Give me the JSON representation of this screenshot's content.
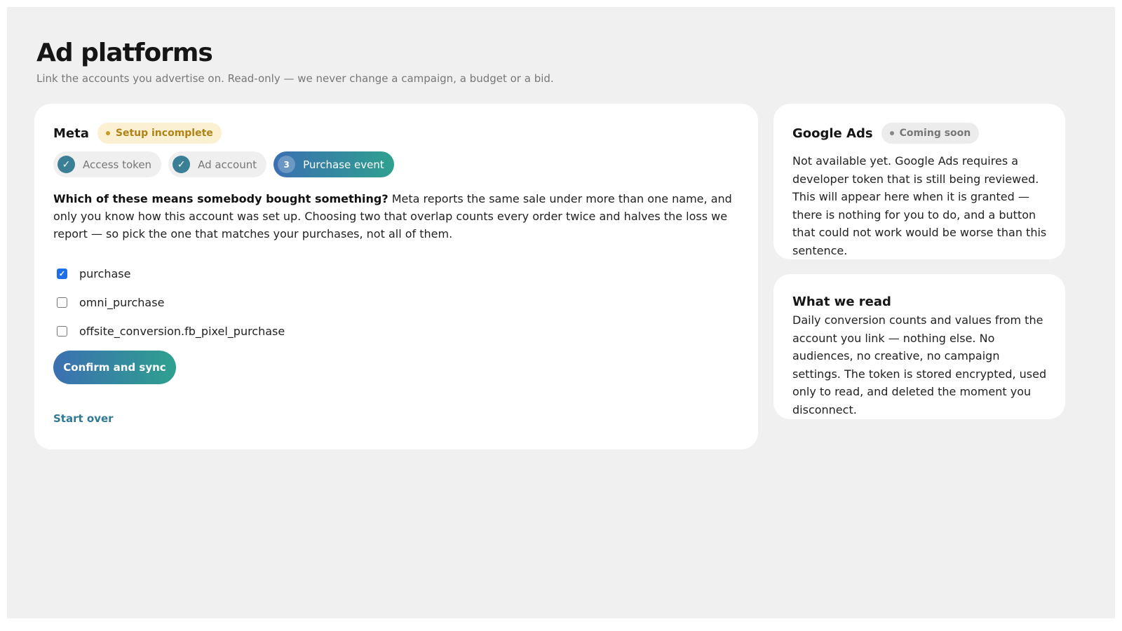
{
  "page": {
    "title": "Ad platforms",
    "subtitle": "Link the accounts you advertise on. Read-only — we never change a campaign, a budget or a bid."
  },
  "meta_card": {
    "name": "Meta",
    "status_badge": "Setup incomplete",
    "steps": [
      {
        "label": "Access token",
        "state": "done",
        "icon": "check-icon"
      },
      {
        "label": "Ad account",
        "state": "done",
        "icon": "check-icon"
      },
      {
        "label": "Purchase event",
        "state": "active",
        "number": "3"
      }
    ],
    "prompt_bold": "Which of these means somebody bought something?",
    "prompt_text": " Meta reports the same sale under more than one name, and only you know how this account was set up. Choosing two that overlap counts every order twice and halves the loss we report — so pick the one that matches your purchases, not all of them.",
    "options": [
      {
        "label": "purchase",
        "checked": true
      },
      {
        "label": "omni_purchase",
        "checked": false
      },
      {
        "label": "offsite_conversion.fb_pixel_purchase",
        "checked": false
      }
    ],
    "confirm_label": "Confirm and sync",
    "start_over_label": "Start over"
  },
  "google_card": {
    "name": "Google Ads",
    "status_badge": "Coming soon",
    "text": "Not available yet. Google Ads requires a developer token that is still being reviewed. This will appear here when it is granted — there is nothing for you to do, and a button that could not work would be worse than this sentence."
  },
  "read_card": {
    "title": "What we read",
    "text": "Daily conversion counts and values from the account you link — nothing else. No audiences, no creative, no campaign settings. The token is stored encrypted, used only to read, and deleted the moment you disconnect."
  },
  "colors": {
    "accent_start": "#3b70b2",
    "accent_end": "#2fa08f",
    "warning": "#b08317",
    "link": "#2f7a92",
    "checkbox": "#1c6fe8"
  }
}
